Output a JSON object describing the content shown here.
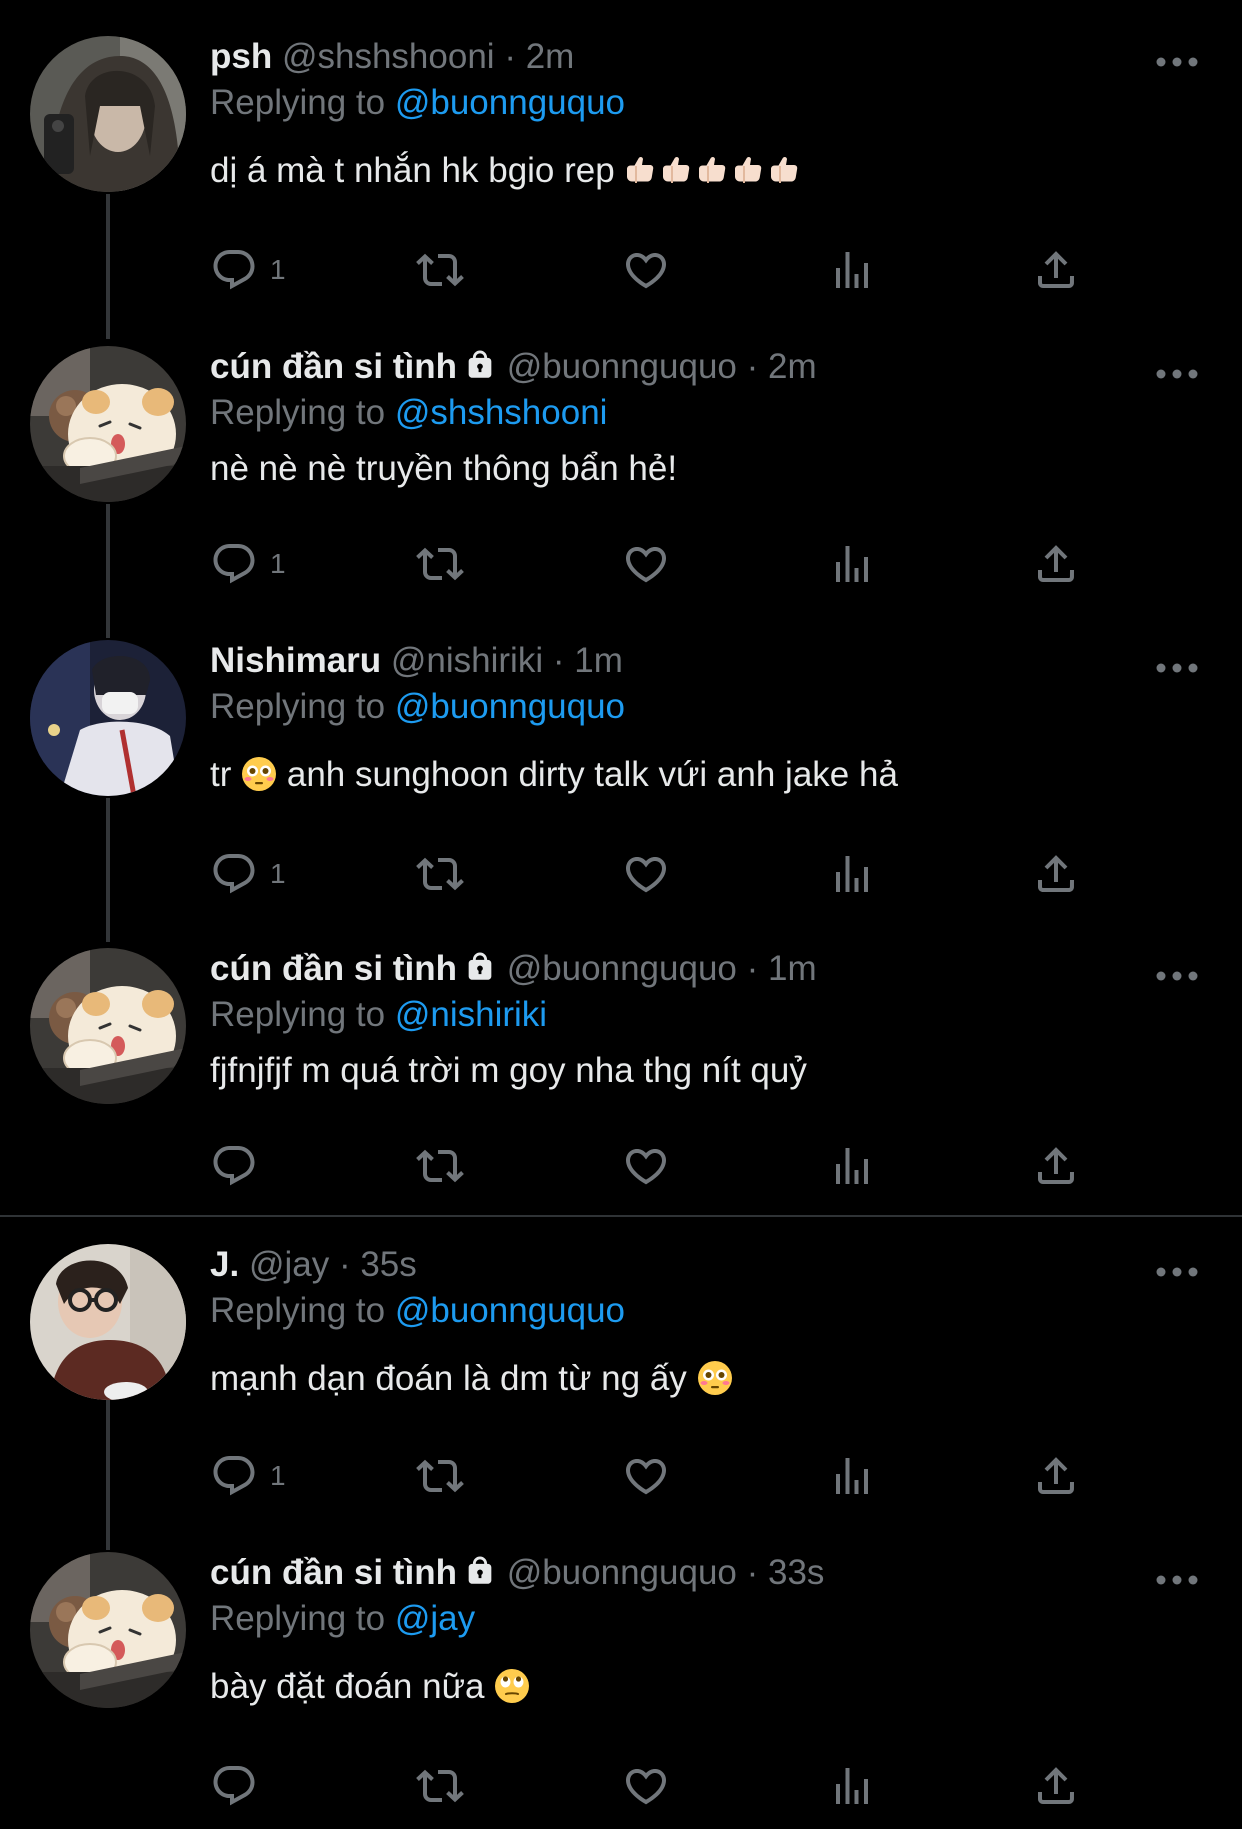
{
  "labels": {
    "replying_to": "Replying to",
    "separator": "·"
  },
  "colors": {
    "background": "#000000",
    "text": "#e7e9ea",
    "muted": "#71767b",
    "accent": "#1d9bf0"
  },
  "tweets": [
    {
      "name": "psh",
      "handle": "@shshshooni",
      "time": "2m",
      "reply_to": "@buonnguquo",
      "text": "dị á mà t nhắn hk bgio rep",
      "emoji": [
        "thumbs-up",
        "thumbs-up",
        "thumbs-up",
        "thumbs-up",
        "thumbs-up"
      ],
      "reply_count": "1",
      "locked": false,
      "avatar": "photo-person-gray"
    },
    {
      "name": "cún đần si tình",
      "handle": "@buonnguquo",
      "time": "2m",
      "reply_to": "@shshshooni",
      "text": "nè nè nè truyền thông bẩn hẻ!",
      "emoji": [],
      "reply_count": "1",
      "locked": true,
      "avatar": "cartoon-dog"
    },
    {
      "name": "Nishimaru",
      "handle": "@nishiriki",
      "time": "1m",
      "reply_to": "@buonnguquo",
      "text_before": "tr",
      "text": "anh sunghoon dirty talk vứi anh jake hả",
      "emoji": [
        "flushed-face"
      ],
      "reply_count": "1",
      "locked": false,
      "avatar": "photo-person-blue"
    },
    {
      "name": "cún đần si tình",
      "handle": "@buonnguquo",
      "time": "1m",
      "reply_to": "@nishiriki",
      "text": "fjfnjfjf m quá trời m goy nha thg nít quỷ",
      "emoji": [],
      "reply_count": "",
      "locked": true,
      "avatar": "cartoon-dog"
    },
    {
      "name": "J.",
      "handle": "@jay",
      "time": "35s",
      "reply_to": "@buonnguquo",
      "text": "mạnh dạn đoán là dm từ ng ấy",
      "emoji": [
        "flushed-face"
      ],
      "reply_count": "1",
      "locked": false,
      "avatar": "photo-person-brown"
    },
    {
      "name": "cún đần si tình",
      "handle": "@buonnguquo",
      "time": "33s",
      "reply_to": "@jay",
      "text": "bày đặt đoán nữa",
      "emoji": [
        "eye-roll-face"
      ],
      "reply_count": "",
      "locked": true,
      "avatar": "cartoon-dog"
    }
  ]
}
